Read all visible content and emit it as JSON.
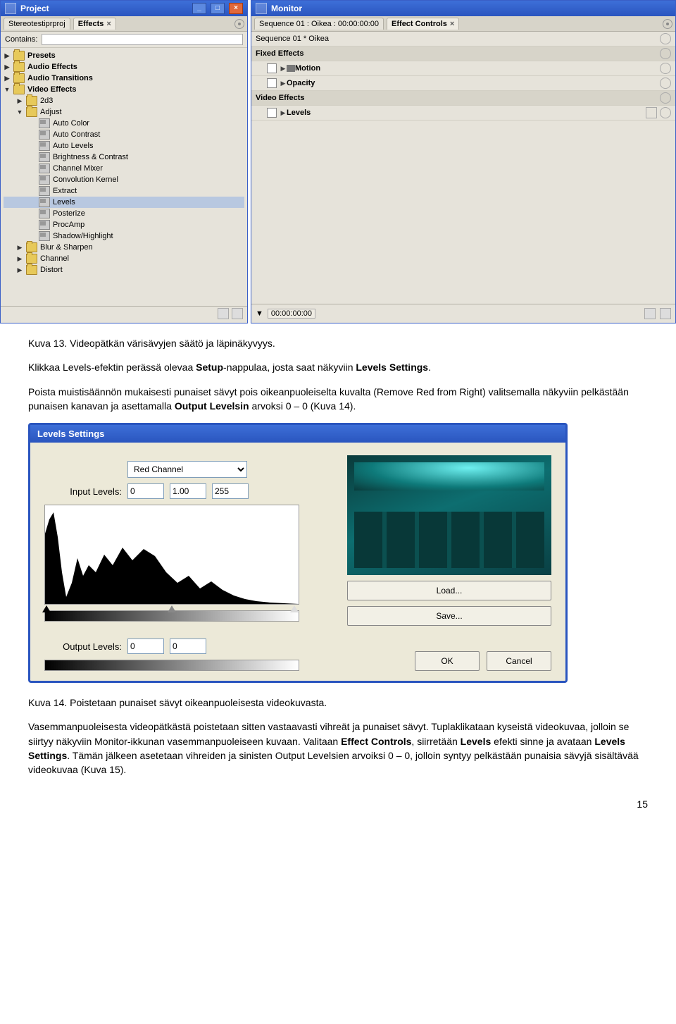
{
  "project": {
    "title": "Project",
    "tab_file": "Stereotestiprproj",
    "tab_effects": "Effects",
    "contains_label": "Contains:",
    "tree": [
      {
        "label": "Presets",
        "icon": "folder",
        "bold": true,
        "indent": 0,
        "arrow": "▶"
      },
      {
        "label": "Audio Effects",
        "icon": "folder",
        "bold": true,
        "indent": 0,
        "arrow": "▶"
      },
      {
        "label": "Audio Transitions",
        "icon": "folder",
        "bold": true,
        "indent": 0,
        "arrow": "▶"
      },
      {
        "label": "Video Effects",
        "icon": "folder",
        "bold": true,
        "indent": 0,
        "arrow": "▼"
      },
      {
        "label": "2d3",
        "icon": "folder",
        "bold": false,
        "indent": 1,
        "arrow": "▶"
      },
      {
        "label": "Adjust",
        "icon": "folder",
        "bold": false,
        "indent": 1,
        "arrow": "▼"
      },
      {
        "label": "Auto Color",
        "icon": "plug",
        "bold": false,
        "indent": 2,
        "arrow": ""
      },
      {
        "label": "Auto Contrast",
        "icon": "plug",
        "bold": false,
        "indent": 2,
        "arrow": ""
      },
      {
        "label": "Auto Levels",
        "icon": "plug",
        "bold": false,
        "indent": 2,
        "arrow": ""
      },
      {
        "label": "Brightness & Contrast",
        "icon": "plug",
        "bold": false,
        "indent": 2,
        "arrow": ""
      },
      {
        "label": "Channel Mixer",
        "icon": "plug",
        "bold": false,
        "indent": 2,
        "arrow": ""
      },
      {
        "label": "Convolution Kernel",
        "icon": "plug",
        "bold": false,
        "indent": 2,
        "arrow": ""
      },
      {
        "label": "Extract",
        "icon": "plug",
        "bold": false,
        "indent": 2,
        "arrow": ""
      },
      {
        "label": "Levels",
        "icon": "plug",
        "bold": false,
        "indent": 2,
        "arrow": "",
        "sel": true
      },
      {
        "label": "Posterize",
        "icon": "plug",
        "bold": false,
        "indent": 2,
        "arrow": ""
      },
      {
        "label": "ProcAmp",
        "icon": "plug",
        "bold": false,
        "indent": 2,
        "arrow": ""
      },
      {
        "label": "Shadow/Highlight",
        "icon": "plug",
        "bold": false,
        "indent": 2,
        "arrow": ""
      },
      {
        "label": "Blur & Sharpen",
        "icon": "folder",
        "bold": false,
        "indent": 1,
        "arrow": "▶"
      },
      {
        "label": "Channel",
        "icon": "folder",
        "bold": false,
        "indent": 1,
        "arrow": "▶"
      },
      {
        "label": "Distort",
        "icon": "folder",
        "bold": false,
        "indent": 1,
        "arrow": "▶"
      }
    ]
  },
  "monitor": {
    "title": "Monitor",
    "tab_seq": "Sequence 01 : Oikea : 00:00:00:00",
    "tab_ec": "Effect Controls",
    "seq_row": "Sequence 01 * Oikea",
    "fixed": "Fixed Effects",
    "motion": "Motion",
    "opacity": "Opacity",
    "video_effects": "Video Effects",
    "levels": "Levels",
    "timecode": "00:00:00:00"
  },
  "caption1": "Kuva 13. Videopätkän värisävyjen säätö ja läpinäkyvyys.",
  "para1a": "Klikkaa Levels-efektin perässä olevaa ",
  "para1b": "Setup",
  "para1c": "-nappulaa, josta saat näkyviin ",
  "para1d": "Levels Settings",
  "para1e": ".",
  "para2a": "Poista muistisäännön mukaisesti punaiset sävyt pois oikeanpuoleiselta kuvalta (Remove Red from Right) valitsemalla näkyviin pelkästään punaisen kanavan ja asettamalla ",
  "para2b": "Output Levelsin",
  "para2c": " arvoksi 0 – 0 (Kuva 14).",
  "levels_dialog": {
    "title": "Levels Settings",
    "select_label": "",
    "channel": "Red Channel",
    "input_levels_label": "Input Levels:",
    "in0": "0",
    "in1": "1.00",
    "in2": "255",
    "output_levels_label": "Output Levels:",
    "out0": "0",
    "out1": "0",
    "load": "Load...",
    "save": "Save...",
    "ok": "OK",
    "cancel": "Cancel"
  },
  "caption2": "Kuva 14. Poistetaan punaiset sävyt oikeanpuoleisesta videokuvasta.",
  "para3a": "Vasemmanpuoleisesta videopätkästä poistetaan sitten vastaavasti vihreät ja punaiset sävyt. Tuplaklikataan kyseistä videokuvaa, jolloin se siirtyy näkyviin Monitor-ikkunan vasemmanpuoleiseen kuvaan. Valitaan ",
  "para3b": "Effect Controls",
  "para3c": ", siirretään ",
  "para3d": "Levels",
  "para3e": " efekti sinne ja avataan ",
  "para3f": "Levels Settings",
  "para3g": ". Tämän jälkeen asetetaan vihreiden ja sinisten Output Levelsien arvoiksi 0 – 0, jolloin syntyy pelkästään punaisia sävyjä sisältävää videokuvaa (Kuva 15).",
  "pagenum": "15"
}
